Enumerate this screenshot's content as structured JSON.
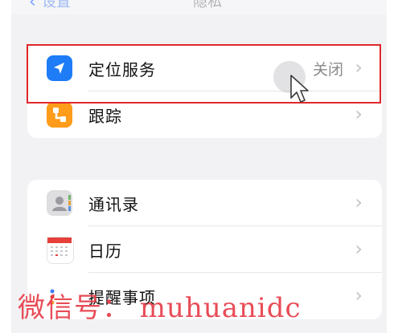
{
  "navbar": {
    "back_label": "设置",
    "title": "隐私"
  },
  "section1": {
    "items": [
      {
        "label": "定位服务",
        "value": "关闭",
        "icon": "location-arrow-icon",
        "color": "#1e7cf6"
      },
      {
        "label": "跟踪",
        "icon": "tracking-icon",
        "color": "#ff9c1a"
      }
    ]
  },
  "section2": {
    "items": [
      {
        "label": "通讯录",
        "icon": "contacts-icon",
        "color": "#dedee0"
      },
      {
        "label": "日历",
        "icon": "calendar-icon",
        "color": "#e5403a"
      },
      {
        "label": "提醒事项",
        "icon": "reminders-icon",
        "color": "#3a7bf5"
      }
    ]
  },
  "watermark": "微信号： muhuanidc",
  "highlight_color": "#e0272b"
}
